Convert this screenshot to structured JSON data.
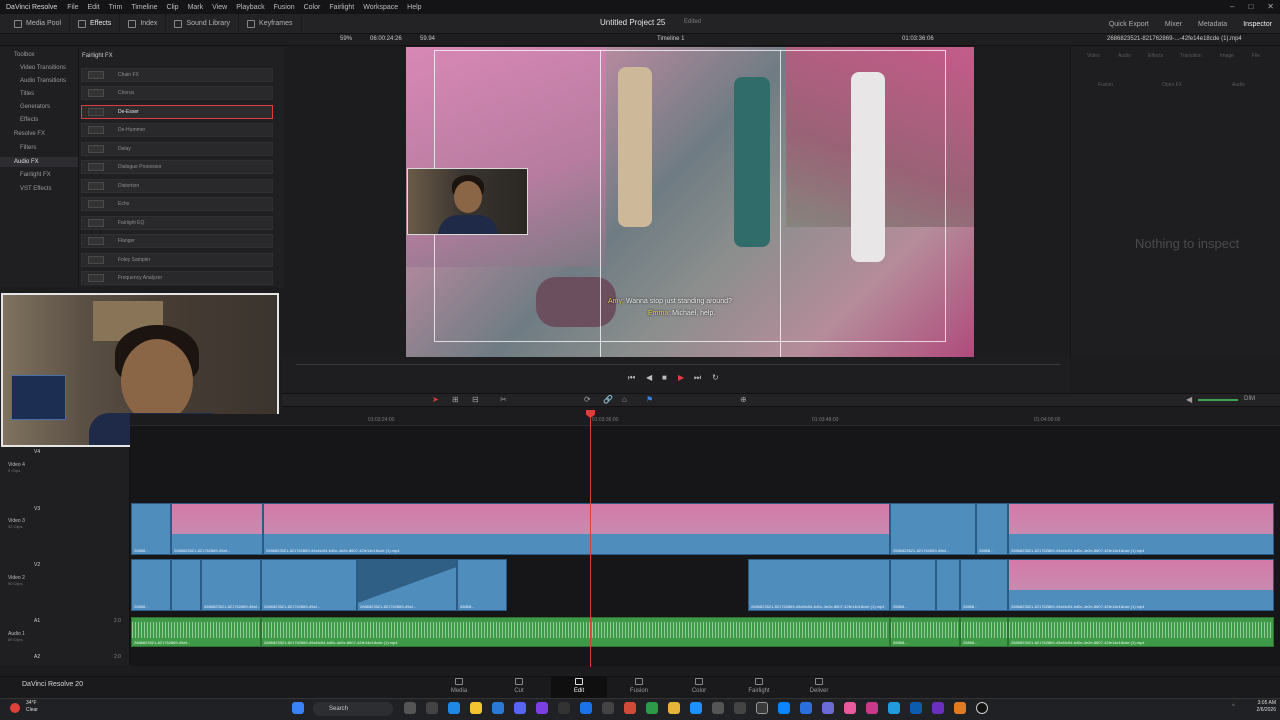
{
  "app": {
    "name": "DaVinci Resolve",
    "menu": [
      "File",
      "Edit",
      "Trim",
      "Timeline",
      "Clip",
      "Mark",
      "View",
      "Playback",
      "Fusion",
      "Color",
      "Fairlight",
      "Workspace",
      "Help"
    ]
  },
  "toolbar": {
    "left": [
      "Media Pool",
      "Effects",
      "Index",
      "Sound Library",
      "Keyframes"
    ],
    "project_title": "Untitled Project 25",
    "project_status": "Edited",
    "right": [
      "Quick Export",
      "Mixer",
      "Metadata",
      "Inspector"
    ]
  },
  "viewer_bar": {
    "zoom": "59%",
    "timecode_left": "06:00:24:26",
    "fps": "59.94",
    "timeline_name": "Timeline 1",
    "timecode_right": "01:03:36:06",
    "clip_name": "2686823521-821762869-...-42fe14e18cde (1).mp4"
  },
  "toolbox": {
    "items": [
      "Toolbox",
      "Video Transitions",
      "Audio Transitions",
      "Titles",
      "Generators",
      "Effects",
      "Resolve FX",
      "Filters",
      "Audio FX",
      "Fairlight FX",
      "VST Effects"
    ]
  },
  "fairlight_fx": {
    "title": "Fairlight FX",
    "items": [
      "Chain FX",
      "Chorus",
      "De-Esser",
      "De-Hummer",
      "Delay",
      "Dialogue Processor",
      "Distortion",
      "Echo",
      "Fairlight EQ",
      "Flanger",
      "Foley Sampler",
      "Frequency Analyzer"
    ],
    "selected": "De-Esser"
  },
  "viewer": {
    "subtitle_line1_name": "Amy:",
    "subtitle_line1_text": "Wanna stop just standing around?",
    "subtitle_line2_name": "Emma:",
    "subtitle_line2_text": "Michael, help."
  },
  "inspector": {
    "tabs": [
      "Video",
      "Audio",
      "Effects",
      "Transition",
      "Image",
      "File"
    ],
    "sub_tabs": [
      "Fusion",
      "Open FX",
      "Audio"
    ],
    "empty_text": "Nothing to inspect"
  },
  "timeline": {
    "ruler": [
      "01:03:24:00",
      "01:03:36:00",
      "01:03:48:00",
      "01:04:00:00"
    ],
    "tracks": [
      {
        "id": "V4",
        "name": "Video 4",
        "clips": "0 Clips"
      },
      {
        "id": "V3",
        "name": "Video 3",
        "clips": "92 Clips"
      },
      {
        "id": "V2",
        "name": "Video 2",
        "clips": "90 Clips"
      },
      {
        "id": "A1",
        "name": "Audio 1",
        "clips": "89 Clips"
      },
      {
        "id": "A2",
        "name": "",
        "clips": ""
      }
    ],
    "clip_label": "2686823521-821762869-49af4c54-b40c-4e2e-8607-42fe14e18cde (1).mp4",
    "clip_label_short": "2686823521-821762869-49af...",
    "clip_label_tiny": "26868...",
    "audio_level": "2.0"
  },
  "pages": [
    "Media",
    "Cut",
    "Edit",
    "Fusion",
    "Color",
    "Fairlight",
    "Deliver"
  ],
  "active_page": "Edit",
  "footer_app": "DaVinci Resolve 20",
  "taskbar": {
    "weather_temp": "34°F",
    "weather_desc": "Clear",
    "search": "Search",
    "time": "3:05 AM",
    "date": "2/6/2026"
  }
}
